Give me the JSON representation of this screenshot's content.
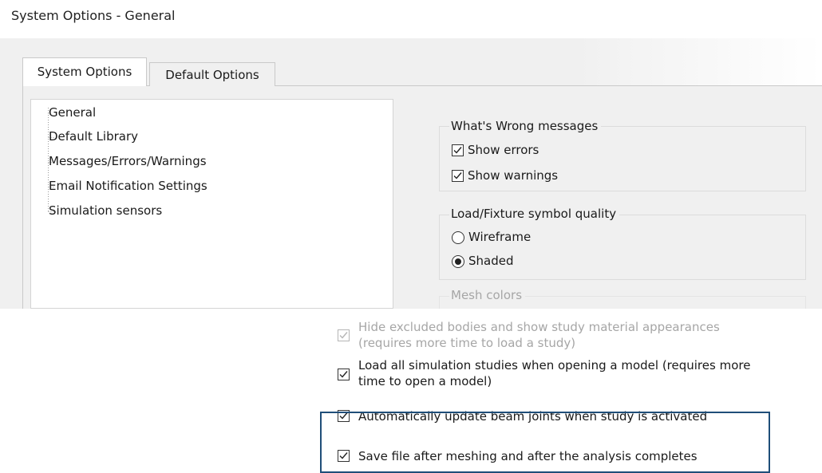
{
  "window": {
    "title": "System Options - General"
  },
  "tabs": [
    {
      "label": "System Options",
      "active": true
    },
    {
      "label": "Default Options",
      "active": false
    }
  ],
  "tree": {
    "items": [
      {
        "label": "General",
        "selected": true
      },
      {
        "label": "Default Library"
      },
      {
        "label": "Messages/Errors/Warnings"
      },
      {
        "label": "Email Notification Settings"
      },
      {
        "label": "Simulation sensors"
      }
    ]
  },
  "whats_wrong": {
    "title": "What's Wrong messages",
    "show_errors": {
      "label": "Show errors",
      "checked": true
    },
    "show_warnings": {
      "label": "Show warnings",
      "checked": true
    }
  },
  "symbol_quality": {
    "title": "Load/Fixture symbol quality",
    "wireframe": {
      "label": "Wireframe",
      "selected": false
    },
    "shaded": {
      "label": "Shaded",
      "selected": true
    }
  },
  "mesh_colors": {
    "title": "Mesh colors"
  },
  "options": {
    "hide_excluded": {
      "line1": "Hide excluded bodies and show study material appearances",
      "line2": "(requires more time to load a study)",
      "checked": true,
      "enabled": false
    },
    "load_all": {
      "line1": "Load all simulation studies when opening a model (requires more",
      "line2": "time to open a model)",
      "checked": true
    },
    "auto_update": {
      "label": "Automatically update beam joints when study is activated",
      "checked": true
    },
    "save_file": {
      "label": "Save file after meshing and after the analysis completes",
      "checked": true
    }
  }
}
